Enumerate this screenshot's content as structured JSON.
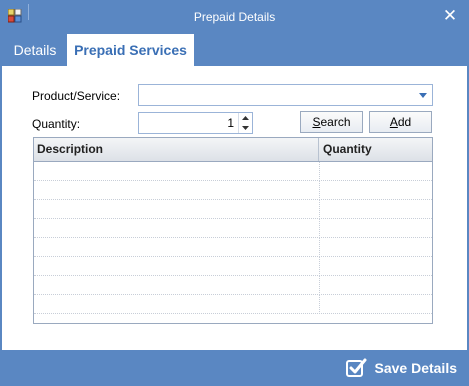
{
  "window": {
    "title": "Prepaid Details",
    "close_glyph": "✕",
    "icon": "app-window-icon"
  },
  "tabs": [
    {
      "label": "Details",
      "active": false
    },
    {
      "label": "Prepaid Services",
      "active": true
    }
  ],
  "form": {
    "product_label": "Product/Service:",
    "product_value": "",
    "quantity_label": "Quantity:",
    "quantity_value": "1",
    "search_label_prefix": "S",
    "search_label_rest": "earch",
    "add_label_prefix": "A",
    "add_label_rest": "dd"
  },
  "grid": {
    "columns": [
      "Description",
      "Quantity"
    ],
    "rows": [
      [
        "",
        ""
      ],
      [
        "",
        ""
      ],
      [
        "",
        ""
      ],
      [
        "",
        ""
      ],
      [
        "",
        ""
      ],
      [
        "",
        ""
      ],
      [
        "",
        ""
      ],
      [
        "",
        ""
      ]
    ]
  },
  "footer": {
    "save_label": "Save Details",
    "save_icon": "checkbox-check-icon"
  },
  "colors": {
    "window_bg": "#5a87c2",
    "accent": "#3a6fb5"
  }
}
